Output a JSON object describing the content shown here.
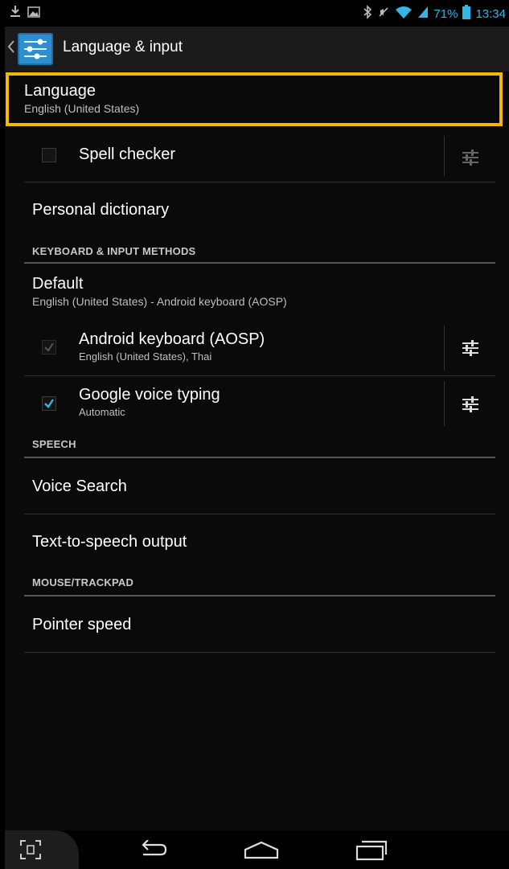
{
  "status_bar": {
    "battery_percent": "71%",
    "time": "13:34",
    "icons_left": [
      "download-icon",
      "image-icon"
    ],
    "icons_right": [
      "bluetooth-icon",
      "no-sound-icon",
      "wifi-icon",
      "signal-icon",
      "battery-icon"
    ]
  },
  "action_bar": {
    "title": "Language & input",
    "app_icon": "settings-sliders-icon",
    "back_icon": "chevron-left-icon"
  },
  "items": {
    "language": {
      "title": "Language",
      "summary": "English (United States)"
    },
    "spell_checker": {
      "title": "Spell checker",
      "checked": false
    },
    "personal_dictionary": {
      "title": "Personal dictionary"
    },
    "header_keyboard": "KEYBOARD & INPUT METHODS",
    "default": {
      "title": "Default",
      "summary": "English (United States) - Android keyboard (AOSP)"
    },
    "android_keyboard": {
      "title": "Android keyboard (AOSP)",
      "summary": "English (United States), Thai",
      "checked": true,
      "disabled": true
    },
    "google_voice": {
      "title": "Google voice typing",
      "summary": "Automatic",
      "checked": true
    },
    "header_speech": "SPEECH",
    "voice_search": {
      "title": "Voice Search"
    },
    "tts": {
      "title": "Text-to-speech output"
    },
    "header_mouse": "MOUSE/TRACKPAD",
    "pointer_speed": {
      "title": "Pointer speed"
    }
  },
  "colors": {
    "accent": "#33b5e5",
    "highlight": "#f5b800",
    "background": "#0a0a0a"
  },
  "nav_bar": {
    "icons": [
      "screenshot-icon",
      "back-icon",
      "home-icon",
      "recents-icon"
    ]
  }
}
